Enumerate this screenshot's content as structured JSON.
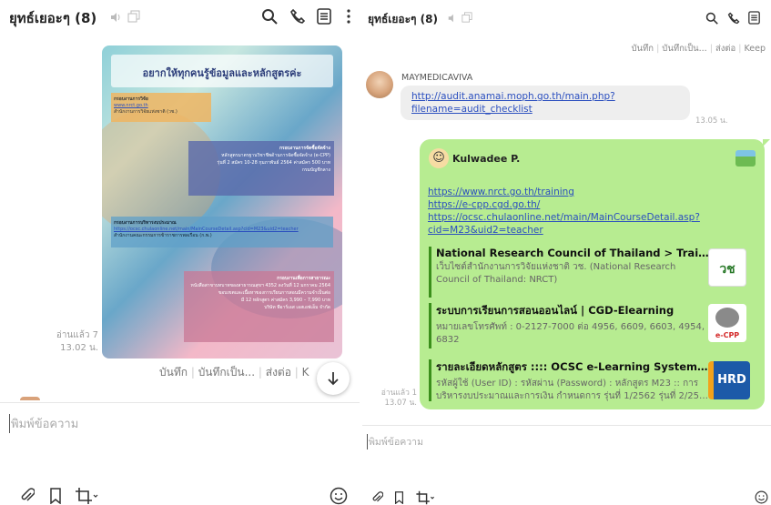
{
  "left": {
    "title": "ยุทธ์เยอะๆ (8)",
    "poster": {
      "heading": "อยากให้ทุกคนรู้ข้อมูลและหลักสูตรค่ะ",
      "block1_title": "กรอบงานการวิจัย",
      "block1_sub": "สำนักงานการวิจัยแห่งชาติ (วช.)",
      "block2_title": "กรอบงานการจัดซื้อจัดจ้าง",
      "block2_line1": "หลักสูตรมาตรฐานวิชาชีพด้านการจัดซื้อจัดจ้าง (e-CPP)",
      "block2_line2": "รุ่นที่ 2 สมัคร 10-28 กุมภาพันธ์ 2564 ค่าสมัคร 500 บาท",
      "block2_line3": "กรมบัญชีกลาง",
      "block3_title": "กรอบงานการบริหารงบประมาณ",
      "block3_sub": "สำนักงานคณะกรรมการข้าราชการพลเรือน (ก.พ.)",
      "block4_title": "กรอบงานเพื่อการสาธารณะ",
      "block4_line1": "หนังสือสาขาบทบาทของสาธารณสุขฯ 4352 ลงวันที่ 12 มกราคม 2564",
      "block4_line2": "ขอบเขตและเนื้อหาของการเรียนการสอนมีความจำเป็นต่อ",
      "block4_line3": "มี 12 หลักสูตร ค่าสมัคร 3,990 – 7,990 บาท",
      "block4_line4": "บริษัท พีอาร์เอส เอสเอฟเอ็ม จำกัด"
    },
    "read_label": "อ่านแล้ว 7",
    "time": "13.02 น.",
    "actions": [
      "บันทึก",
      "บันทึกเป็น...",
      "ส่งต่อ",
      "K"
    ],
    "input_placeholder": "พิมพ์ข้อความ"
  },
  "right": {
    "title": "ยุทธ์เยอะๆ (8)",
    "top_actions": [
      "บันทึก",
      "บันทึกเป็น...",
      "ส่งต่อ",
      "Keep"
    ],
    "msg1": {
      "sender": "MAYMEDICAVIVA",
      "link_line1": "http://audit.anamai.moph.go.th/main.php?",
      "link_line2": "filename=audit_checklist",
      "time": "13.05 น."
    },
    "msg2": {
      "sender": "Kulwadee P.",
      "links": [
        "https://www.nrct.go.th/training",
        "https://e-cpp.cgd.go.th/",
        "https://ocsc.chulaonline.net/main/MainCourseDetail.asp?",
        "cid=M23&uid2=teacher"
      ],
      "previews": [
        {
          "title": "National Research Council of Thailand > Training",
          "desc": "เว็บไซต์สำนักงานการวิจัยแห่งชาติ วช. (National Research Council of Thailand: NRCT)",
          "thumb": "วช"
        },
        {
          "title": "ระบบการเรียนการสอนออนไลน์ | CGD-Elearning",
          "desc": "หมายเลขโทรศัพท์ : 0-2127-7000 ต่อ 4956, 6609, 6603, 4954, 6832",
          "thumb": "e-CPP"
        },
        {
          "title": "รายละเอียดหลักสูตร  :::: OCSC e-Learning System (Pow…",
          "desc": "รหัสผู้ใช้ (User ID) : รหัสผ่าน (Password) : หลักสูตร M23 :: การบริหารงบประมาณและการเงิน กำหนดการ รุ่นที่ 1/2562 รุ่นที่ 2/25…",
          "thumb": "HRD"
        }
      ],
      "read_label": "อ่านแล้ว 1",
      "time": "13.07 น."
    },
    "input_placeholder": "พิมพ์ข้อความ"
  },
  "colors": {
    "bubble_green": "#b7ec91",
    "bubble_gray": "#eeeeee",
    "link": "#2b4fbf",
    "accent_bar": "#3b8f1b"
  },
  "icons": [
    "volume-icon",
    "copy-icon",
    "search-icon",
    "phone-icon",
    "notes-icon",
    "more-icon",
    "down-arrow-icon",
    "attach-icon",
    "bookmark-icon",
    "crop-icon",
    "emoji-icon"
  ]
}
